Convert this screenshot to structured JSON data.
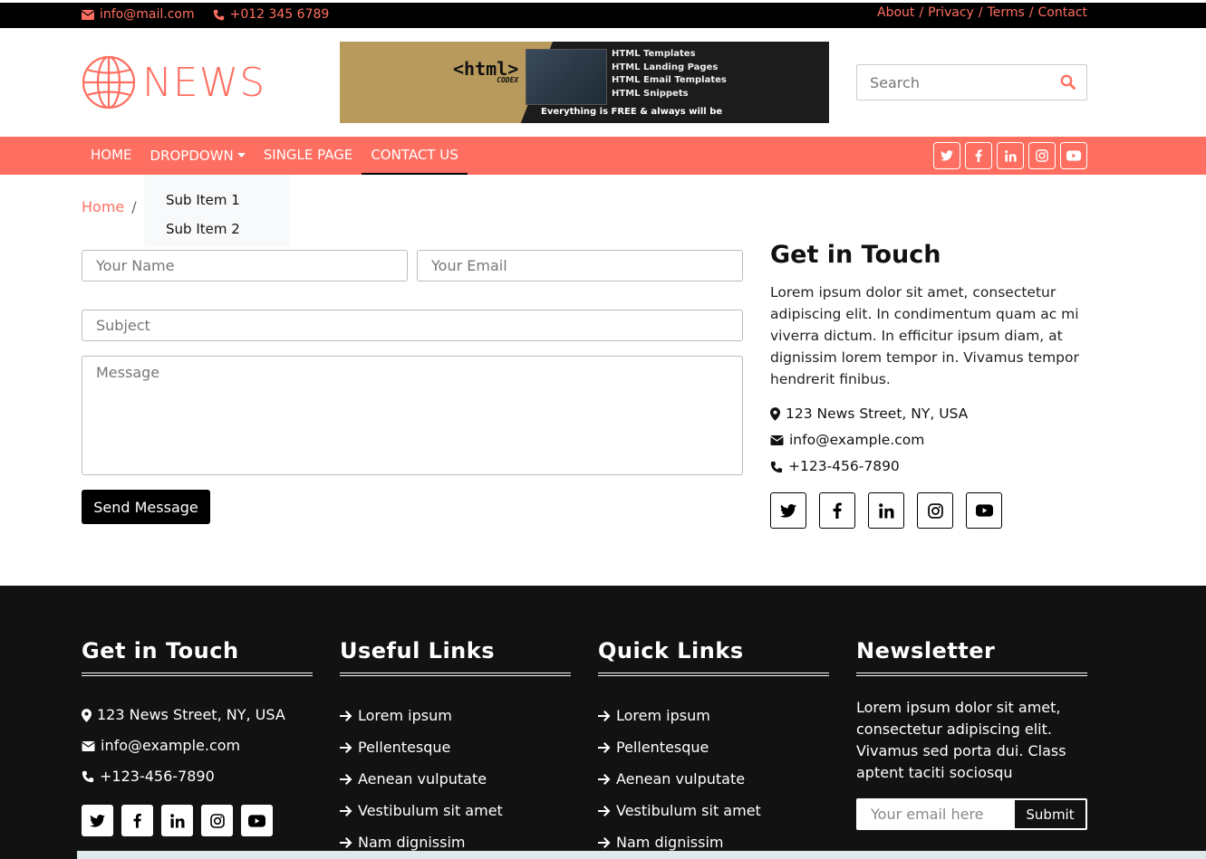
{
  "topbar": {
    "email": "info@mail.com",
    "phone": "+012 345 6789",
    "links": [
      "About",
      "Privacy",
      "Terms",
      "Contact"
    ],
    "separator": "/"
  },
  "header": {
    "logo_text": "NEWS",
    "banner": {
      "brand": "<html>",
      "brand_sub": "CODEX",
      "items": [
        "HTML Templates",
        "HTML Landing Pages",
        "HTML Email Templates",
        "HTML Snippets"
      ],
      "tagline": "Everything is FREE & always will be"
    },
    "search_placeholder": "Search"
  },
  "nav": {
    "items": [
      "HOME",
      "DROPDOWN",
      "SINGLE PAGE",
      "CONTACT US"
    ],
    "active": "CONTACT US",
    "dropdown_items": [
      "Sub Item 1",
      "Sub Item 2"
    ]
  },
  "breadcrumb": {
    "home": "Home",
    "separator": "/"
  },
  "form": {
    "name_placeholder": "Your Name",
    "email_placeholder": "Your Email",
    "subject_placeholder": "Subject",
    "message_placeholder": "Message",
    "send_label": "Send Message"
  },
  "contact_info": {
    "title": "Get in Touch",
    "description": "Lorem ipsum dolor sit amet, consectetur adipiscing elit. In condimentum quam ac mi viverra dictum. In efficitur ipsum diam, at dignissim lorem tempor in. Vivamus tempor hendrerit finibus.",
    "address": "123 News Street, NY, USA",
    "email": "info@example.com",
    "phone": "+123-456-7890"
  },
  "footer": {
    "col1": {
      "title": "Get in Touch",
      "address": "123 News Street, NY, USA",
      "email": "info@example.com",
      "phone": "+123-456-7890"
    },
    "col2": {
      "title": "Useful Links",
      "links": [
        "Lorem ipsum",
        "Pellentesque",
        "Aenean vulputate",
        "Vestibulum sit amet",
        "Nam dignissim"
      ]
    },
    "col3": {
      "title": "Quick Links",
      "links": [
        "Lorem ipsum",
        "Pellentesque",
        "Aenean vulputate",
        "Vestibulum sit amet",
        "Nam dignissim"
      ]
    },
    "col4": {
      "title": "Newsletter",
      "text": "Lorem ipsum dolor sit amet, consectetur adipiscing elit. Vivamus sed porta dui. Class aptent taciti sociosqu",
      "email_placeholder": "Your email here",
      "submit_label": "Submit"
    }
  },
  "colors": {
    "accent": "#FF6F61",
    "dark": "#121212",
    "black": "#000000"
  }
}
